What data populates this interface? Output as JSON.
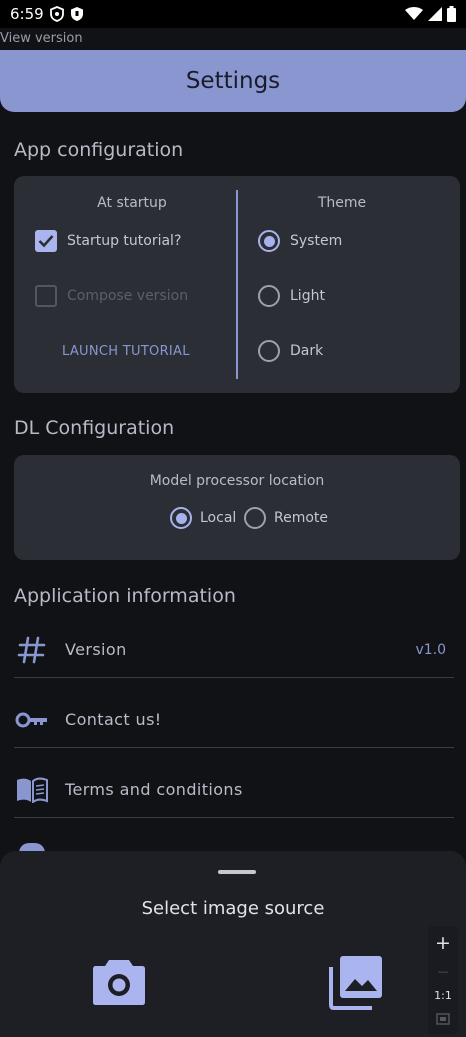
{
  "status_bar": {
    "time": "6:59"
  },
  "view_version": "View version",
  "header": {
    "title": "Settings"
  },
  "app_config": {
    "title": "App configuration",
    "startup": {
      "title": "At startup",
      "tutorial_label": "Startup tutorial?",
      "tutorial_checked": true,
      "compose_label": "Compose version",
      "compose_checked": false,
      "launch_label": "LAUNCH TUTORIAL"
    },
    "theme": {
      "title": "Theme",
      "options": [
        "System",
        "Light",
        "Dark"
      ],
      "selected": "System"
    }
  },
  "dl_config": {
    "title": "DL Configuration",
    "processor_title": "Model processor location",
    "options": [
      "Local",
      "Remote"
    ],
    "selected": "Local"
  },
  "app_info": {
    "title": "Application information",
    "items": [
      {
        "label": "Version",
        "value": "v1.0",
        "icon": "hash-icon"
      },
      {
        "label": "Contact us!",
        "icon": "key-icon"
      },
      {
        "label": "Terms and conditions",
        "icon": "book-icon"
      }
    ]
  },
  "sheet": {
    "title": "Select image source",
    "options": [
      {
        "icon": "camera-icon"
      },
      {
        "icon": "gallery-icon"
      }
    ]
  },
  "zoom_controls": {
    "plus": "+",
    "minus": "—",
    "ratio": "1:1"
  },
  "colors": {
    "accent": "#8a96d0",
    "background": "#111216",
    "card": "#2c2e35",
    "sheet": "#1e1f24"
  }
}
